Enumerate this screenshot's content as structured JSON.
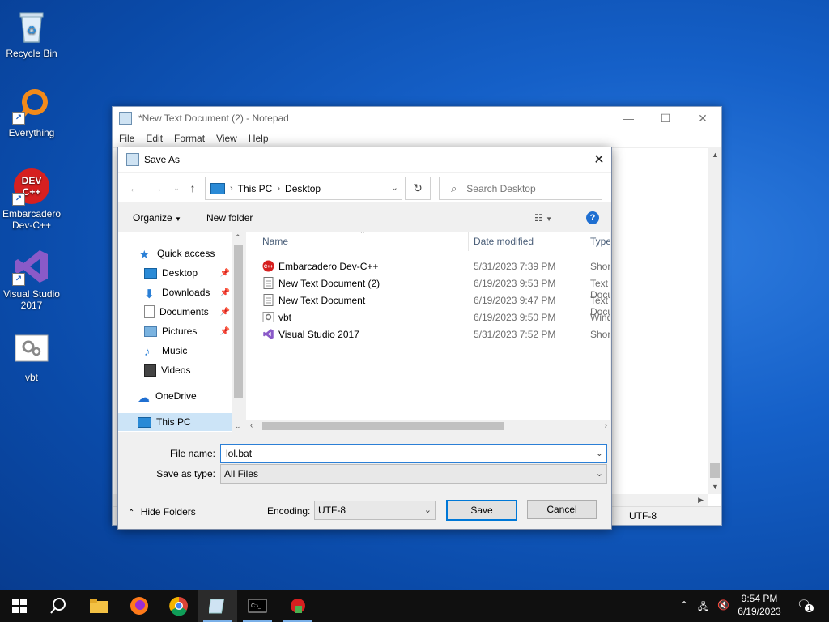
{
  "desktop": {
    "icons": [
      {
        "label": "Recycle Bin"
      },
      {
        "label": "Everything"
      },
      {
        "label": "Embarcadero Dev-C++"
      },
      {
        "label": "Visual Studio 2017"
      },
      {
        "label": "vbt"
      }
    ]
  },
  "notepad": {
    "title": "*New Text Document (2) - Notepad",
    "menu": [
      "File",
      "Edit",
      "Format",
      "View",
      "Help"
    ],
    "status_encoding": "UTF-8",
    "controls": {
      "minimize": "—",
      "maximize": "☐",
      "close": "✕"
    }
  },
  "dialog": {
    "title": "Save As",
    "close": "✕",
    "address": [
      "This PC",
      "Desktop"
    ],
    "search_placeholder": "Search Desktop",
    "toolbar": {
      "organize": "Organize",
      "new_folder": "New folder",
      "help": "?"
    },
    "nav": [
      {
        "label": "Quick access",
        "pinned": false
      },
      {
        "label": "Desktop",
        "pinned": true
      },
      {
        "label": "Downloads",
        "pinned": true
      },
      {
        "label": "Documents",
        "pinned": true
      },
      {
        "label": "Pictures",
        "pinned": true
      },
      {
        "label": "Music",
        "pinned": false
      },
      {
        "label": "Videos",
        "pinned": false
      },
      {
        "label": "OneDrive",
        "pinned": false
      },
      {
        "label": "This PC",
        "pinned": false
      }
    ],
    "columns": {
      "name": "Name",
      "date": "Date modified",
      "type": "Type"
    },
    "files": [
      {
        "name": "Embarcadero Dev-C++",
        "date": "5/31/2023 7:39 PM",
        "type": "Shortcut",
        "icon": "devcpp-icon"
      },
      {
        "name": "New Text Document (2)",
        "date": "6/19/2023 9:53 PM",
        "type": "Text Document",
        "icon": "text-file-icon"
      },
      {
        "name": "New Text Document",
        "date": "6/19/2023 9:47 PM",
        "type": "Text Document",
        "icon": "text-file-icon"
      },
      {
        "name": "vbt",
        "date": "6/19/2023 9:50 PM",
        "type": "Windows",
        "icon": "gear-file-icon"
      },
      {
        "name": "Visual Studio 2017",
        "date": "5/31/2023 7:52 PM",
        "type": "Shortcut",
        "icon": "visual-studio-icon"
      }
    ],
    "file_name_label": "File name:",
    "file_name_value": "lol.bat",
    "save_type_label": "Save as type:",
    "save_type_value": "All Files",
    "hide_folders": "Hide Folders",
    "encoding_label": "Encoding:",
    "encoding_value": "UTF-8",
    "save_label": "Save",
    "cancel_label": "Cancel"
  },
  "taskbar": {
    "time": "9:54 PM",
    "date": "6/19/2023",
    "notifications": "1"
  }
}
